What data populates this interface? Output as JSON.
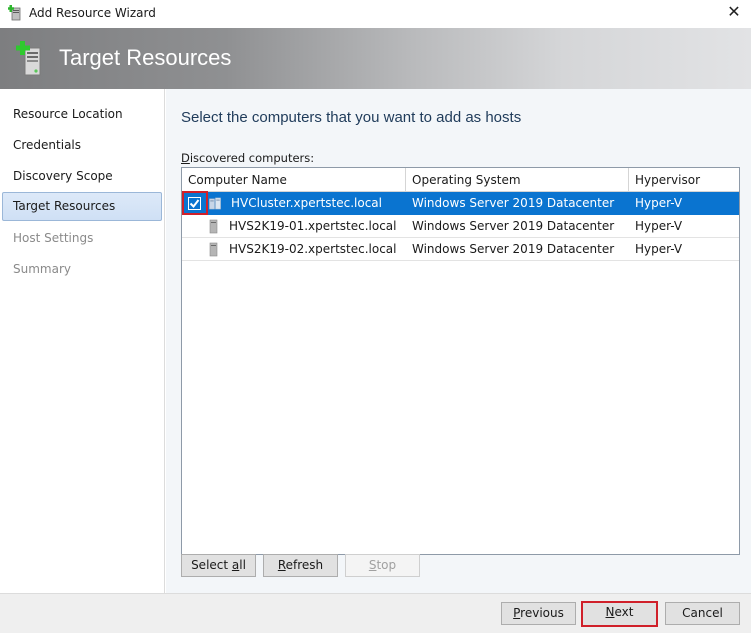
{
  "window": {
    "title": "Add Resource Wizard",
    "close_icon": "close-icon"
  },
  "banner": {
    "title": "Target Resources",
    "icon": "add-server-icon"
  },
  "sidebar": {
    "items": [
      {
        "label": "Resource Location",
        "state": "completed"
      },
      {
        "label": "Credentials",
        "state": "completed"
      },
      {
        "label": "Discovery Scope",
        "state": "completed"
      },
      {
        "label": "Target Resources",
        "state": "active"
      },
      {
        "label": "Host Settings",
        "state": "disabled"
      },
      {
        "label": "Summary",
        "state": "disabled"
      }
    ]
  },
  "main": {
    "heading": "Select the computers that you want to add as hosts",
    "list_label_accel": "D",
    "list_label_rest": "iscovered computers:",
    "columns": [
      "Computer Name",
      "Operating System",
      "Hypervisor"
    ],
    "rows": [
      {
        "name": "HVCluster.xpertstec.local",
        "os": "Windows Server 2019 Datacenter",
        "hypervisor": "Hyper-V",
        "checked": true,
        "selected": true,
        "icon": "cluster-icon"
      },
      {
        "name": "HVS2K19-01.xpertstec.local",
        "os": "Windows Server 2019 Datacenter",
        "hypervisor": "Hyper-V",
        "checked": false,
        "selected": false,
        "icon": "server-icon"
      },
      {
        "name": "HVS2K19-02.xpertstec.local",
        "os": "Windows Server 2019 Datacenter",
        "hypervisor": "Hyper-V",
        "checked": false,
        "selected": false,
        "icon": "server-icon"
      }
    ],
    "buttons": {
      "select_all_pre": "Select ",
      "select_all_accel": "a",
      "select_all_post": "ll",
      "refresh_accel": "R",
      "refresh_post": "efresh",
      "stop_accel": "S",
      "stop_post": "top"
    }
  },
  "footer": {
    "previous_accel": "P",
    "previous_post": "revious",
    "next_accel": "N",
    "next_post": "ext",
    "cancel": "Cancel"
  },
  "colors": {
    "selection": "#0a74d0",
    "highlight_frame": "#d0202a",
    "heading": "#1f3b5a"
  }
}
